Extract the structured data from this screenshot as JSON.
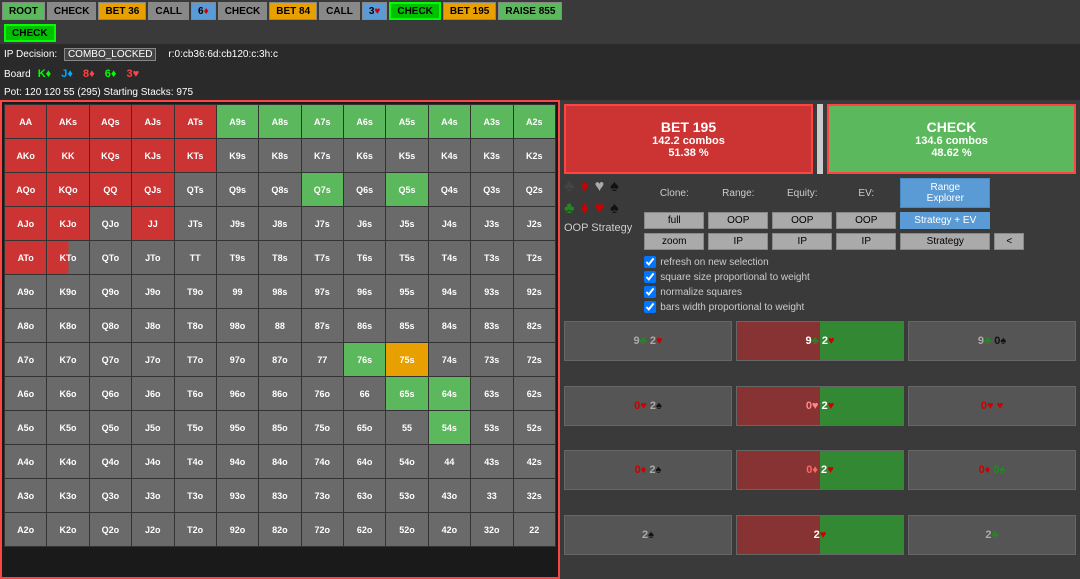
{
  "topnav": {
    "items": [
      {
        "label": "ROOT",
        "style": "green",
        "id": "root"
      },
      {
        "label": "CHECK",
        "style": "gray",
        "id": "check1"
      },
      {
        "label": "BET 36",
        "style": "orange",
        "id": "bet36"
      },
      {
        "label": "CALL",
        "style": "gray",
        "id": "call1"
      },
      {
        "label": "6♦",
        "style": "blue",
        "id": "6d"
      },
      {
        "label": "CHECK",
        "style": "gray",
        "id": "check2"
      },
      {
        "label": "BET 84",
        "style": "orange",
        "id": "bet84"
      },
      {
        "label": "CALL",
        "style": "gray",
        "id": "call2"
      },
      {
        "label": "3♥",
        "style": "blue",
        "id": "3h"
      },
      {
        "label": "CHECK",
        "style": "active-green",
        "id": "check3"
      },
      {
        "label": "BET 195",
        "style": "orange",
        "id": "bet195"
      },
      {
        "label": "RAISE 855",
        "style": "green",
        "id": "raise855"
      }
    ],
    "second_item": "CHECK"
  },
  "ip_decision": "COMBO_LOCKED",
  "range_path": "r:0:cb36:6d:cb120:c:3h:c",
  "board": {
    "label": "Board",
    "cards": [
      "K♦",
      "J♦",
      "8♦",
      "6♦",
      "3♥"
    ]
  },
  "pot_info": "Pot: 120  120  55  (295)  Starting Stacks: 975",
  "actions": [
    {
      "label": "BET 195",
      "combos": "142.2 combos",
      "pct": "51.38 %",
      "style": "red"
    },
    {
      "label": "CHECK",
      "combos": "134.6 combos",
      "pct": "48.62 %",
      "style": "green"
    }
  ],
  "controls": {
    "clone_label": "Clone:",
    "range_label": "Range:",
    "equity_label": "Equity:",
    "ev_label": "EV:",
    "range_explorer": "Range Explorer",
    "full_btn": "full",
    "zoom_btn": "zoom",
    "oop_label1": "OOP",
    "oop_label2": "OOP",
    "oop_label3": "OOP",
    "ip_label1": "IP",
    "ip_label2": "IP",
    "ip_label3": "IP",
    "strategy_ev": "Strategy + EV",
    "strategy": "Strategy",
    "chevron": "<",
    "oop_strategy": "OOP Strategy"
  },
  "checkboxes": [
    {
      "label": "refresh on new selection",
      "checked": true
    },
    {
      "label": "square size proportional to weight",
      "checked": true
    },
    {
      "label": "normalize squares",
      "checked": true
    },
    {
      "label": "bars width proportional to weight",
      "checked": true
    }
  ],
  "card_cells": [
    {
      "label": "9♣ 2♥",
      "style": "gray"
    },
    {
      "label": "9♣ 2♥",
      "style": "red-green"
    },
    {
      "label": "9♣ 0♠",
      "style": "gray"
    },
    {
      "label": "0♥ 2♠",
      "style": "gray"
    },
    {
      "label": "0♥ 2♥",
      "style": "red-green"
    },
    {
      "label": "0♥ ♥",
      "style": "gray"
    },
    {
      "label": "0♦ 2♠",
      "style": "gray"
    },
    {
      "label": "0♦ 2♥",
      "style": "red-green"
    },
    {
      "label": "0♦ 0♠",
      "style": "gray"
    },
    {
      "label": "2♠",
      "style": "gray"
    },
    {
      "label": "2♥",
      "style": "red-green"
    },
    {
      "label": "2♠",
      "style": "gray"
    }
  ],
  "matrix": {
    "headers": [
      "AA",
      "AKs",
      "AQs",
      "AJs",
      "ATs",
      "A9s",
      "A8s",
      "A7s",
      "A6s",
      "A5s",
      "A4s",
      "A3s",
      "A2s"
    ],
    "rows": [
      [
        "AA",
        "AKs",
        "AQs",
        "AJs",
        "ATs",
        "A9s",
        "A8s",
        "A7s",
        "A6s",
        "A5s",
        "A4s",
        "A3s",
        "A2s"
      ],
      [
        "AKo",
        "KK",
        "KQs",
        "KJs",
        "KTs",
        "K9s",
        "K8s",
        "K7s",
        "K6s",
        "K5s",
        "K4s",
        "K3s",
        "K2s"
      ],
      [
        "AQo",
        "KQo",
        "QQ",
        "QJs",
        "QTs",
        "Q9s",
        "Q8s",
        "Q7s",
        "Q6s",
        "Q5s",
        "Q4s",
        "Q3s",
        "Q2s"
      ],
      [
        "AJo",
        "KJo",
        "QJo",
        "JJ",
        "JTs",
        "J9s",
        "J8s",
        "J7s",
        "J6s",
        "J5s",
        "J4s",
        "J3s",
        "J2s"
      ],
      [
        "ATo",
        "KTo",
        "QTo",
        "JTo",
        "TT",
        "T9s",
        "T8s",
        "T7s",
        "T6s",
        "T5s",
        "T4s",
        "T3s",
        "T2s"
      ],
      [
        "A9o",
        "K9o",
        "Q9o",
        "J9o",
        "T9o",
        "99",
        "98s",
        "97s",
        "96s",
        "95s",
        "94s",
        "93s",
        "92s"
      ],
      [
        "A8o",
        "K8o",
        "Q8o",
        "J8o",
        "T8o",
        "98o",
        "88",
        "87s",
        "86s",
        "85s",
        "84s",
        "83s",
        "82s"
      ],
      [
        "A7o",
        "K7o",
        "Q7o",
        "J7o",
        "T7o",
        "97o",
        "87o",
        "77",
        "76s",
        "75s",
        "74s",
        "73s",
        "72s"
      ],
      [
        "A6o",
        "K6o",
        "Q6o",
        "J6o",
        "T6o",
        "96o",
        "86o",
        "76o",
        "66",
        "65s",
        "64s",
        "63s",
        "62s"
      ],
      [
        "A5o",
        "K5o",
        "Q5o",
        "J5o",
        "T5o",
        "95o",
        "85o",
        "75o",
        "65o",
        "55",
        "54s",
        "53s",
        "52s"
      ],
      [
        "A4o",
        "K4o",
        "Q4o",
        "J4o",
        "T4o",
        "94o",
        "84o",
        "74o",
        "64o",
        "54o",
        "44",
        "43s",
        "42s"
      ],
      [
        "A3o",
        "K3o",
        "Q3o",
        "J3o",
        "T3o",
        "93o",
        "83o",
        "73o",
        "63o",
        "53o",
        "43o",
        "33",
        "32s"
      ],
      [
        "A2o",
        "K2o",
        "Q2o",
        "J2o",
        "T2o",
        "92o",
        "82o",
        "72o",
        "62o",
        "52o",
        "42o",
        "32o",
        "22"
      ]
    ],
    "cell_colors": {
      "AA": "red",
      "AKs": "red",
      "AQs": "red",
      "AJs": "red",
      "ATs": "red",
      "A9s": "green",
      "A8s": "green",
      "A7s": "green",
      "A6s": "green",
      "A5s": "green",
      "A4s": "green",
      "A3s": "green",
      "A2s": "green",
      "AKo": "red",
      "KK": "red",
      "KQs": "red",
      "KJs": "red",
      "KTs": "red",
      "K9s": "gray",
      "K8s": "gray",
      "K7s": "gray",
      "K6s": "gray",
      "K5s": "gray",
      "K4s": "gray",
      "K3s": "gray",
      "K2s": "gray",
      "AQo": "red",
      "KQo": "red",
      "QQ": "red",
      "QJs": "red",
      "QTs": "gray",
      "Q9s": "gray",
      "Q8s": "gray",
      "Q7s": "green",
      "Q6s": "gray",
      "Q5s": "green",
      "Q4s": "gray",
      "Q3s": "gray",
      "Q2s": "gray",
      "AJo": "red",
      "KJo": "red",
      "QJo": "gray",
      "JJ": "red",
      "JTs": "gray",
      "J9s": "gray",
      "J8s": "gray",
      "J7s": "gray",
      "J6s": "gray",
      "J5s": "gray",
      "J4s": "gray",
      "J3s": "gray",
      "J2s": "gray",
      "ATo": "mixed-rg",
      "KTo": "mixed-rg",
      "QTo": "gray",
      "JTo": "gray",
      "TT": "gray",
      "T9s": "gray",
      "T8s": "gray",
      "T7s": "gray",
      "T6s": "gray",
      "T5s": "gray",
      "T4s": "gray",
      "T3s": "gray",
      "T2s": "gray",
      "A9o": "gray",
      "K9o": "gray",
      "Q9o": "gray",
      "J9o": "gray",
      "T9o": "gray",
      "99": "gray",
      "98s": "gray",
      "97s": "gray",
      "96s": "gray",
      "95s": "gray",
      "94s": "gray",
      "93s": "gray",
      "92s": "gray",
      "A8o": "gray",
      "K8o": "gray",
      "Q8o": "gray",
      "J8o": "gray",
      "T8o": "gray",
      "98o": "gray",
      "88": "gray",
      "87s": "gray",
      "86s": "gray",
      "85s": "gray",
      "84s": "gray",
      "83s": "gray",
      "82s": "gray",
      "A7o": "gray",
      "K7o": "gray",
      "Q7o": "gray",
      "J7o": "gray",
      "T7o": "gray",
      "97o": "gray",
      "87o": "gray",
      "77": "gray",
      "76s": "green",
      "75s": "orange",
      "74s": "gray",
      "73s": "gray",
      "72s": "gray",
      "A6o": "gray",
      "K6o": "gray",
      "Q6o": "gray",
      "J6o": "gray",
      "T6o": "gray",
      "96o": "gray",
      "86o": "gray",
      "76o": "gray",
      "66": "gray",
      "65s": "green",
      "64s": "green",
      "63s": "gray",
      "62s": "gray",
      "A5o": "gray",
      "K5o": "gray",
      "Q5o": "gray",
      "J5o": "gray",
      "T5o": "gray",
      "95o": "gray",
      "85o": "gray",
      "75o": "gray",
      "65o": "gray",
      "55": "gray",
      "54s": "green",
      "53s": "gray",
      "52s": "gray",
      "A4o": "gray",
      "K4o": "gray",
      "Q4o": "gray",
      "J4o": "gray",
      "T4o": "gray",
      "94o": "gray",
      "84o": "gray",
      "74o": "gray",
      "64o": "gray",
      "54o": "gray",
      "44": "gray",
      "43s": "gray",
      "42s": "gray",
      "A3o": "gray",
      "K3o": "gray",
      "Q3o": "gray",
      "J3o": "gray",
      "T3o": "gray",
      "93o": "gray",
      "83o": "gray",
      "73o": "gray",
      "63o": "gray",
      "53o": "gray",
      "43o": "gray",
      "33": "gray",
      "32s": "gray",
      "A2o": "gray",
      "K2o": "gray",
      "Q2o": "gray",
      "J2o": "gray",
      "T2o": "gray",
      "92o": "gray",
      "82o": "gray",
      "72o": "gray",
      "62o": "gray",
      "52o": "gray",
      "42o": "gray",
      "32o": "gray",
      "22": "gray"
    }
  }
}
